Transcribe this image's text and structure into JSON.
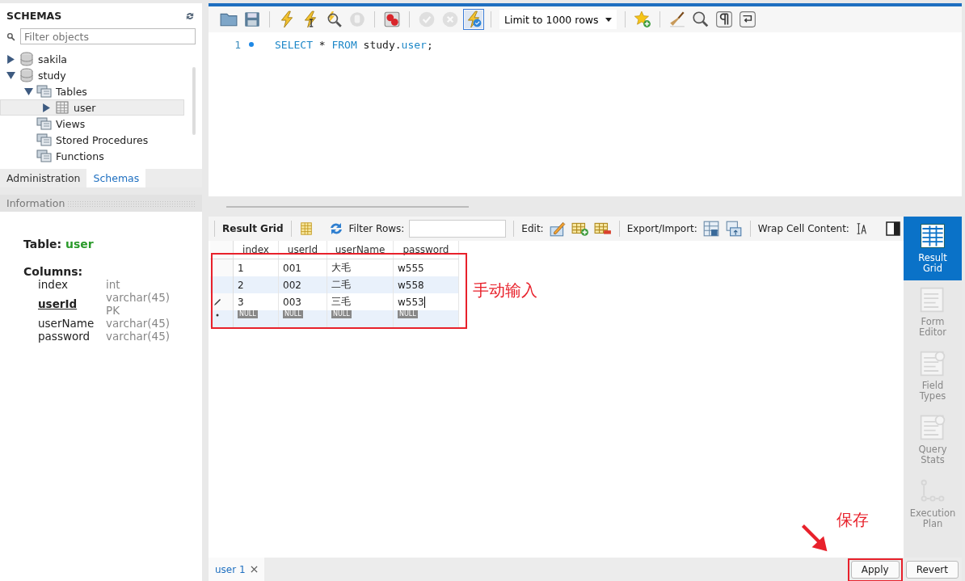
{
  "schemas_panel": {
    "title": "SCHEMAS",
    "filter": {
      "placeholder": "Filter objects"
    },
    "tree": [
      {
        "label": "sakila",
        "kind": "database",
        "expanded": false,
        "selected": false
      },
      {
        "label": "study",
        "kind": "database",
        "expanded": true,
        "selected": false,
        "children": [
          {
            "label": "Tables",
            "kind": "folder",
            "expanded": true,
            "selected": false,
            "children": [
              {
                "label": "user",
                "kind": "table",
                "expanded": false,
                "selected": true
              }
            ]
          },
          {
            "label": "Views",
            "kind": "folder",
            "selected": false
          },
          {
            "label": "Stored Procedures",
            "kind": "folder",
            "selected": false
          },
          {
            "label": "Functions",
            "kind": "folder",
            "selected": false
          }
        ]
      }
    ]
  },
  "sidebar_tabs": [
    {
      "label": "Administration",
      "selected": false
    },
    {
      "label": "Schemas",
      "selected": true
    }
  ],
  "info_panel": {
    "title": "Information",
    "table_label": "Table:",
    "table_name": "user",
    "columns_label": "Columns:",
    "columns": [
      {
        "name": "index",
        "type": "int",
        "primary_key": false
      },
      {
        "name": "userId",
        "type": "varchar(45)",
        "note": "PK",
        "primary_key": true
      },
      {
        "name": "userName",
        "type": "varchar(45)",
        "primary_key": false
      },
      {
        "name": "password",
        "type": "varchar(45)",
        "primary_key": false
      }
    ]
  },
  "query_toolbar": {
    "stop": {
      "disabled": true
    },
    "commit": {
      "disabled": true
    },
    "rollback": {
      "disabled": true
    },
    "autocommit": {
      "on": true
    },
    "limit": {
      "value": "Limit to 1000 rows"
    }
  },
  "editor": {
    "lines": [
      {
        "number": "1",
        "marker": true,
        "tokens": [
          {
            "text": "SELECT",
            "kind": "keyword"
          },
          {
            "text": " * ",
            "kind": "plain"
          },
          {
            "text": "FROM",
            "kind": "keyword"
          },
          {
            "text": " study.",
            "kind": "plain"
          },
          {
            "text": "user",
            "kind": "keyword"
          },
          {
            "text": ";",
            "kind": "plain"
          }
        ]
      }
    ]
  },
  "result_toolbar": {
    "title": "Result Grid",
    "filter_label": "Filter Rows:",
    "edit_label": "Edit:",
    "export_label": "Export/Import:",
    "wrap_label": "Wrap Cell Content:"
  },
  "grid": {
    "columns": [
      "index",
      "userId",
      "userName",
      "password"
    ],
    "rows": [
      {
        "kind": "data",
        "editing": false,
        "cells": [
          "1",
          "001",
          "大毛",
          "w555"
        ]
      },
      {
        "kind": "data",
        "editing": false,
        "cells": [
          "2",
          "002",
          "二毛",
          "w558"
        ]
      },
      {
        "kind": "data",
        "editing": true,
        "cells": [
          "3",
          "003",
          "三毛",
          "w553"
        ]
      },
      {
        "kind": "new",
        "cells": [
          "NULL",
          "NULL",
          "NULL",
          "NULL"
        ]
      }
    ]
  },
  "side_views": [
    {
      "label": "Result Grid",
      "selected": true
    },
    {
      "label": "Form Editor",
      "selected": false
    },
    {
      "label": "Field Types",
      "selected": false
    },
    {
      "label": "Query Stats",
      "selected": false
    },
    {
      "label": "Execution Plan",
      "selected": false
    }
  ],
  "bottom_bar": {
    "tabs": [
      {
        "label": "user 1",
        "selected": true
      }
    ],
    "buttons": [
      "Apply",
      "Revert"
    ]
  },
  "annotations": {
    "rows_note": "手动输入",
    "apply_note": "保存"
  }
}
